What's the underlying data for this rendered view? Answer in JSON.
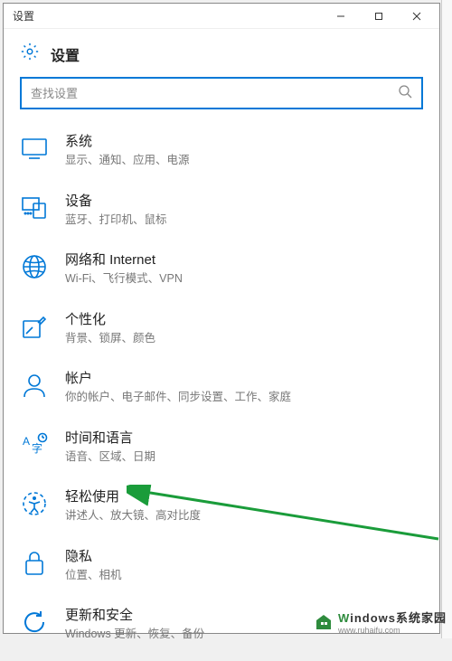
{
  "window": {
    "title": "设置"
  },
  "header": {
    "title": "设置"
  },
  "search": {
    "placeholder": "查找设置"
  },
  "items": [
    {
      "title": "系统",
      "sub": "显示、通知、应用、电源",
      "icon": "system"
    },
    {
      "title": "设备",
      "sub": "蓝牙、打印机、鼠标",
      "icon": "devices"
    },
    {
      "title": "网络和 Internet",
      "sub": "Wi-Fi、飞行模式、VPN",
      "icon": "network"
    },
    {
      "title": "个性化",
      "sub": "背景、锁屏、颜色",
      "icon": "personalization"
    },
    {
      "title": "帐户",
      "sub": "你的帐户、电子邮件、同步设置、工作、家庭",
      "icon": "accounts"
    },
    {
      "title": "时间和语言",
      "sub": "语音、区域、日期",
      "icon": "time-lang"
    },
    {
      "title": "轻松使用",
      "sub": "讲述人、放大镜、高对比度",
      "icon": "ease"
    },
    {
      "title": "隐私",
      "sub": "位置、相机",
      "icon": "privacy"
    },
    {
      "title": "更新和安全",
      "sub": "Windows 更新、恢复、备份",
      "icon": "update"
    }
  ],
  "watermark": {
    "line1a": "W",
    "line1b": "indows",
    "line1c": "系统家园",
    "line2": "www.ruhaifu.com"
  }
}
